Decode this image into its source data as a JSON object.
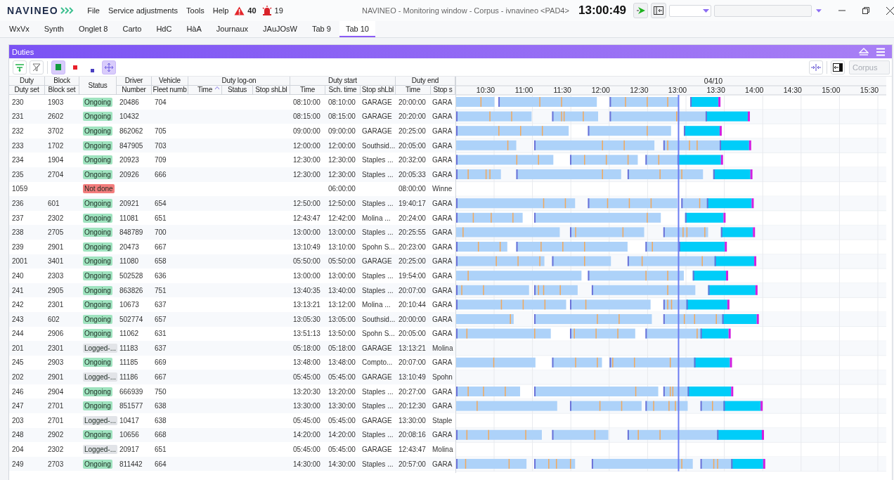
{
  "app": {
    "logo": "NAVINEO",
    "menu": [
      "File",
      "Service adjustments",
      "Tools",
      "Help"
    ],
    "alerts": [
      {
        "kind": "warning",
        "count": "40"
      },
      {
        "kind": "alarm",
        "count": "19"
      }
    ],
    "title": "NAVINEO - Monitoring window - Corpus - ivnavineo <PAD4>",
    "clock": "13:00:49"
  },
  "tabs": [
    {
      "label": "WxVx",
      "selected": false
    },
    {
      "label": "Synth",
      "selected": false
    },
    {
      "label": "Onglet 8",
      "selected": false
    },
    {
      "label": "Carto",
      "selected": false
    },
    {
      "label": "HdC",
      "selected": false
    },
    {
      "label": "HàA",
      "selected": false
    },
    {
      "label": "Journaux",
      "selected": false
    },
    {
      "label": "JAuJOsW",
      "selected": false
    },
    {
      "label": "Tab 9",
      "selected": false
    },
    {
      "label": "Tab 10",
      "selected": true
    }
  ],
  "panel": {
    "title": "Duties",
    "toolbar": [
      {
        "kind": "filter",
        "selected": false
      },
      {
        "kind": "filter_clear",
        "selected": false
      },
      {
        "kind": "green_square",
        "selected": true
      },
      {
        "kind": "red_square",
        "selected": false
      },
      {
        "kind": "blue_square",
        "selected": false
      },
      {
        "kind": "move",
        "selected": true
      }
    ],
    "layer_select": {
      "value": "Corpus",
      "disabled": true
    },
    "table": {
      "column_groups": [
        {
          "label": "Duty",
          "columns": [
            {
              "label": "Duty set",
              "sorted": false
            }
          ]
        },
        {
          "label": "Block",
          "columns": [
            {
              "label": "Block set",
              "sorted": false
            }
          ]
        },
        {
          "label": "Status"
        },
        {
          "label": "Driver",
          "columns": [
            {
              "label": "Number",
              "sorted": false
            }
          ]
        },
        {
          "label": "Vehicle",
          "columns": [
            {
              "label": "Fleet numb",
              "sorted": false
            }
          ]
        },
        {
          "label": "Duty log-on",
          "columns": [
            {
              "label": "Time",
              "sorted": true
            },
            {
              "label": "Status",
              "sorted": false
            },
            {
              "label": "Stop shLbl",
              "sorted": false
            }
          ]
        },
        {
          "label": "Duty start",
          "columns": [
            {
              "label": "Time",
              "sorted": false
            },
            {
              "label": "Sch. time",
              "sorted": false
            },
            {
              "label": "Stop shLbl",
              "sorted": false
            }
          ]
        },
        {
          "label": "Duty end",
          "columns": [
            {
              "label": "Time",
              "sorted": false
            },
            {
              "label": "Stop s",
              "sorted": false
            }
          ]
        }
      ],
      "rows": [
        {
          "duty": "230",
          "block": "1903",
          "status": {
            "kind": "ongoing",
            "label": "Ongoing"
          },
          "driver": "20486",
          "vehicle": "704",
          "start_time": "08:10:00",
          "sch_time": "08:10:00",
          "start_stop": "GARAGE",
          "end_time": "20:00:00",
          "end_stop": "GARA"
        },
        {
          "duty": "231",
          "block": "2602",
          "status": {
            "kind": "ongoing",
            "label": "Ongoing"
          },
          "driver": "10432",
          "start_time": "08:15:00",
          "sch_time": "08:15:00",
          "start_stop": "GARAGE",
          "end_time": "20:20:00",
          "end_stop": "GARA"
        },
        {
          "duty": "232",
          "block": "3702",
          "status": {
            "kind": "ongoing",
            "label": "Ongoing"
          },
          "driver": "862062",
          "vehicle": "705",
          "start_time": "09:00:00",
          "sch_time": "09:00:00",
          "start_stop": "GARAGE",
          "end_time": "20:25:00",
          "end_stop": "GARA"
        },
        {
          "duty": "233",
          "block": "1702",
          "status": {
            "kind": "ongoing",
            "label": "Ongoing"
          },
          "driver": "847905",
          "vehicle": "703",
          "start_time": "12:00:00",
          "sch_time": "12:00:00",
          "start_stop": "Southsid...",
          "end_time": "20:05:00",
          "end_stop": "GARA"
        },
        {
          "duty": "234",
          "block": "1904",
          "status": {
            "kind": "ongoing",
            "label": "Ongoing"
          },
          "driver": "20923",
          "vehicle": "709",
          "start_time": "12:30:00",
          "sch_time": "12:30:00",
          "start_stop": "Staples ...",
          "end_time": "20:32:00",
          "end_stop": "GARA"
        },
        {
          "duty": "235",
          "block": "2704",
          "status": {
            "kind": "ongoing",
            "label": "Ongoing"
          },
          "driver": "20926",
          "vehicle": "666",
          "start_time": "12:30:00",
          "sch_time": "12:30:00",
          "start_stop": "Staples ...",
          "end_time": "20:05:33",
          "end_stop": "GARA"
        },
        {
          "duty": "1059",
          "status": {
            "kind": "not_done",
            "label": "Not done"
          },
          "sch_time": "06:00:00",
          "end_time": "08:00:00",
          "end_stop": "Winne"
        },
        {
          "duty": "236",
          "block": "601",
          "status": {
            "kind": "ongoing",
            "label": "Ongoing"
          },
          "driver": "20921",
          "vehicle": "654",
          "start_time": "12:50:00",
          "sch_time": "12:50:00",
          "start_stop": "Staples ...",
          "end_time": "19:40:17",
          "end_stop": "GARA"
        },
        {
          "duty": "237",
          "block": "2302",
          "status": {
            "kind": "ongoing",
            "label": "Ongoing"
          },
          "driver": "11081",
          "vehicle": "651",
          "start_time": "12:43:47",
          "sch_time": "12:42:00",
          "start_stop": "Molina ...",
          "end_time": "20:24:00",
          "end_stop": "GARA"
        },
        {
          "duty": "238",
          "block": "2705",
          "status": {
            "kind": "ongoing",
            "label": "Ongoing"
          },
          "driver": "848789",
          "vehicle": "700",
          "start_time": "13:00:00",
          "sch_time": "13:00:00",
          "start_stop": "Staples ...",
          "end_time": "20:25:55",
          "end_stop": "GARA"
        },
        {
          "duty": "239",
          "block": "2901",
          "status": {
            "kind": "ongoing",
            "label": "Ongoing"
          },
          "driver": "20473",
          "vehicle": "667",
          "start_time": "13:10:49",
          "sch_time": "13:10:00",
          "start_stop": "Spohn S...",
          "end_time": "20:23:00",
          "end_stop": "GARA"
        },
        {
          "duty": "2001",
          "block": "3401",
          "status": {
            "kind": "ongoing",
            "label": "Ongoing"
          },
          "driver": "11080",
          "vehicle": "658",
          "start_time": "05:50:00",
          "sch_time": "05:50:00",
          "start_stop": "GARAGE",
          "end_time": "20:25:00",
          "end_stop": "GARA"
        },
        {
          "duty": "240",
          "block": "2303",
          "status": {
            "kind": "ongoing",
            "label": "Ongoing"
          },
          "driver": "502528",
          "vehicle": "636",
          "start_time": "13:00:00",
          "sch_time": "13:00:00",
          "start_stop": "Staples ...",
          "end_time": "19:54:00",
          "end_stop": "GARA"
        },
        {
          "duty": "241",
          "block": "2905",
          "status": {
            "kind": "ongoing",
            "label": "Ongoing"
          },
          "driver": "863826",
          "vehicle": "751",
          "start_time": "13:40:35",
          "sch_time": "13:40:00",
          "start_stop": "Staples ...",
          "end_time": "20:07:00",
          "end_stop": "GARA"
        },
        {
          "duty": "242",
          "block": "2301",
          "status": {
            "kind": "ongoing",
            "label": "Ongoing"
          },
          "driver": "10673",
          "vehicle": "637",
          "start_time": "13:13:21",
          "sch_time": "13:12:00",
          "start_stop": "Molina ...",
          "end_time": "20:10:44",
          "end_stop": "GARA"
        },
        {
          "duty": "243",
          "block": "602",
          "status": {
            "kind": "ongoing",
            "label": "Ongoing"
          },
          "driver": "502774",
          "vehicle": "657",
          "start_time": "13:05:30",
          "sch_time": "13:05:00",
          "start_stop": "Southsid...",
          "end_time": "20:00:00",
          "end_stop": "GARA"
        },
        {
          "duty": "244",
          "block": "2906",
          "status": {
            "kind": "ongoing",
            "label": "Ongoing"
          },
          "driver": "11062",
          "vehicle": "631",
          "start_time": "13:51:13",
          "sch_time": "13:50:00",
          "start_stop": "Spohn S...",
          "end_time": "20:05:00",
          "end_stop": "GARA"
        },
        {
          "duty": "201",
          "block": "2301",
          "status": {
            "kind": "logged_off",
            "label": "Logged-..."
          },
          "driver": "11183",
          "vehicle": "637",
          "start_time": "05:18:00",
          "sch_time": "05:18:00",
          "start_stop": "GARAGE",
          "end_time": "13:13:21",
          "end_stop": "Molina"
        },
        {
          "duty": "245",
          "block": "2903",
          "status": {
            "kind": "ongoing",
            "label": "Ongoing"
          },
          "driver": "11185",
          "vehicle": "669",
          "start_time": "13:48:00",
          "sch_time": "13:48:00",
          "start_stop": "Compto...",
          "end_time": "20:07:00",
          "end_stop": "GARA"
        },
        {
          "duty": "202",
          "block": "2901",
          "status": {
            "kind": "logged_off",
            "label": "Logged-..."
          },
          "driver": "11186",
          "vehicle": "667",
          "start_time": "05:45:00",
          "sch_time": "05:45:00",
          "start_stop": "GARAGE",
          "end_time": "13:10:49",
          "end_stop": "Spohn"
        },
        {
          "duty": "246",
          "block": "2904",
          "status": {
            "kind": "ongoing",
            "label": "Ongoing"
          },
          "driver": "666939",
          "vehicle": "750",
          "start_time": "13:20:30",
          "sch_time": "13:20:00",
          "start_stop": "Staples ...",
          "end_time": "20:27:00",
          "end_stop": "GARA"
        },
        {
          "duty": "247",
          "block": "2701",
          "status": {
            "kind": "ongoing",
            "label": "Ongoing"
          },
          "driver": "851577",
          "vehicle": "638",
          "start_time": "13:30:00",
          "sch_time": "13:30:00",
          "start_stop": "Staples ...",
          "end_time": "20:12:30",
          "end_stop": "GARA"
        },
        {
          "duty": "203",
          "block": "2701",
          "status": {
            "kind": "logged_off",
            "label": "Logged-..."
          },
          "driver": "10417",
          "vehicle": "638",
          "start_time": "05:45:00",
          "sch_time": "05:45:00",
          "start_stop": "GARAGE",
          "end_time": "13:30:00",
          "end_stop": "Staple"
        },
        {
          "duty": "248",
          "block": "2902",
          "status": {
            "kind": "ongoing",
            "label": "Ongoing"
          },
          "driver": "10656",
          "vehicle": "668",
          "start_time": "14:20:00",
          "sch_time": "14:20:00",
          "start_stop": "Staples ...",
          "end_time": "20:08:16",
          "end_stop": "GARA"
        },
        {
          "duty": "204",
          "block": "2302",
          "status": {
            "kind": "logged_off",
            "label": "Logged-..."
          },
          "driver": "20917",
          "vehicle": "651",
          "start_time": "05:45:00",
          "sch_time": "05:45:00",
          "start_stop": "GARAGE",
          "end_time": "12:43:47",
          "end_stop": "Molina"
        },
        {
          "duty": "249",
          "block": "2703",
          "status": {
            "kind": "ongoing",
            "label": "Ongoing"
          },
          "driver": "811442",
          "vehicle": "664",
          "start_time": "14:30:00",
          "sch_time": "14:30:00",
          "start_stop": "Staples ...",
          "end_time": "20:57:00",
          "end_stop": "GARA"
        }
      ]
    },
    "gantt": {
      "date": "04/10",
      "ticks": [
        "10:30",
        "11:00",
        "11:30",
        "12:00",
        "12:30",
        "13:00",
        "13:30",
        "14:00",
        "14:30",
        "15:00",
        "15:30"
      ]
    }
  }
}
